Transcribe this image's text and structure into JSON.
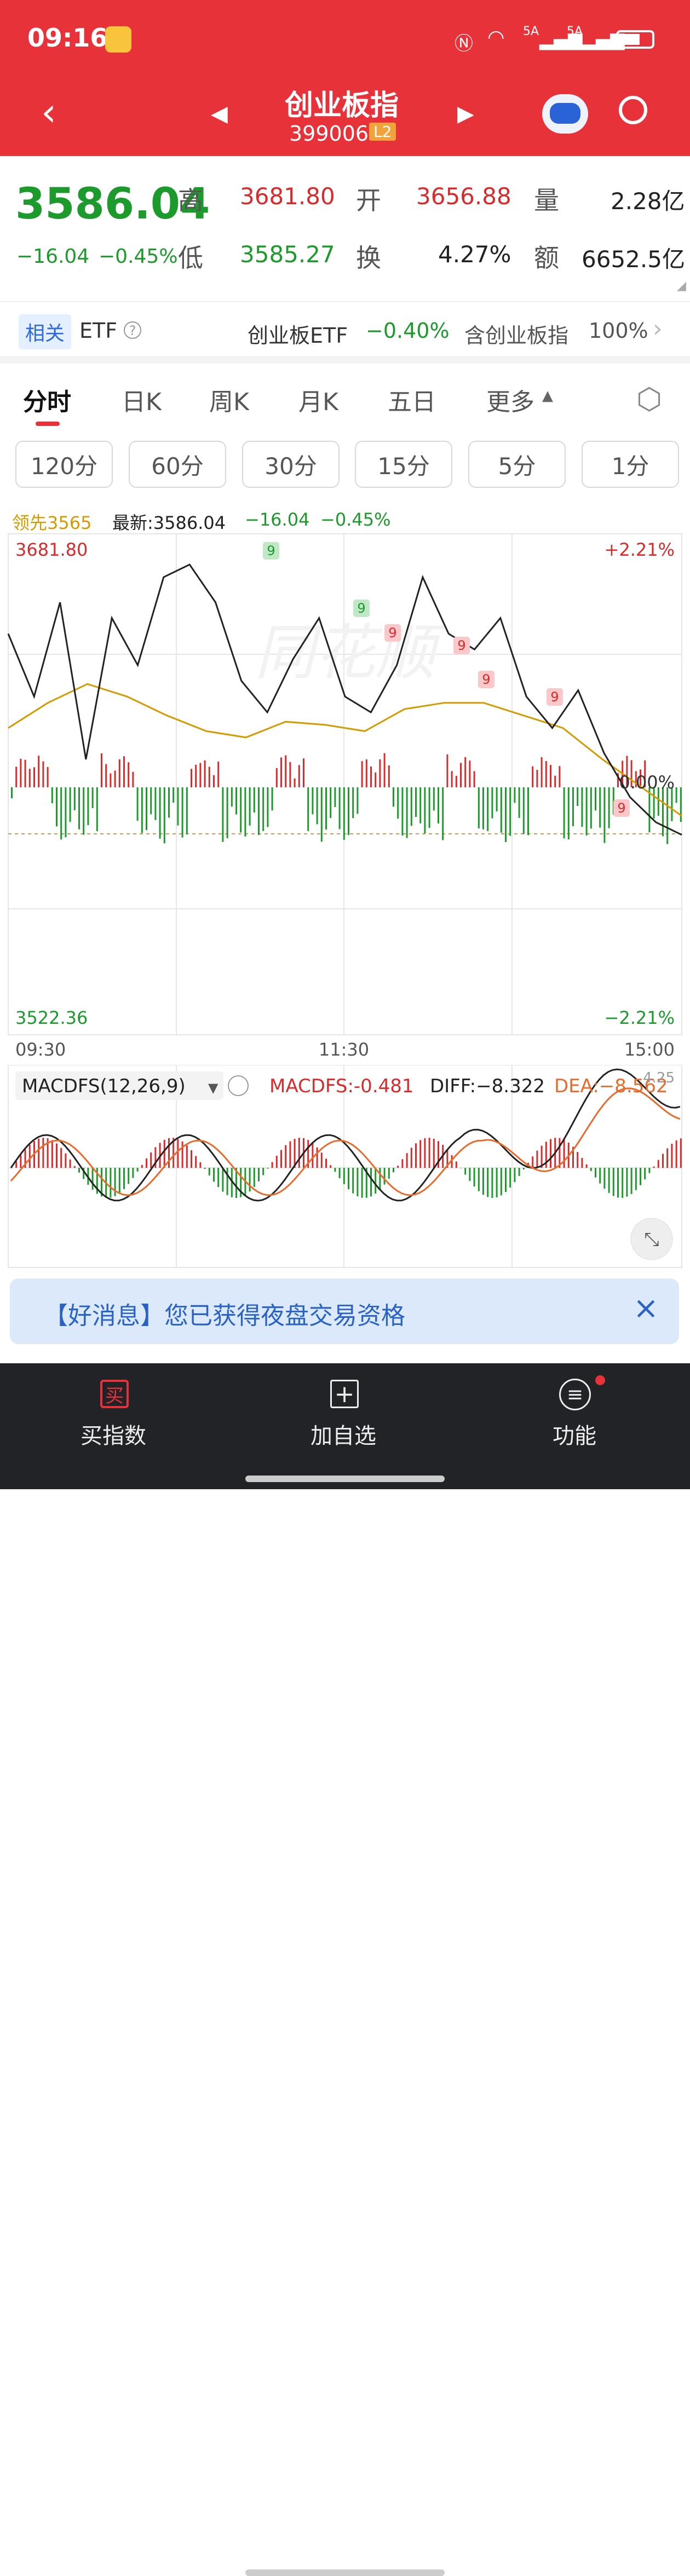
{
  "status_bar": {
    "time": "09:16",
    "signal1": "5A",
    "signal2": "5A"
  },
  "header": {
    "title": "创业板指",
    "code": "399006",
    "badge": "L2"
  },
  "quote": {
    "price": "3586.04",
    "change": "−16.04",
    "change_pct": "−0.45%",
    "high_label": "高",
    "high": "3681.80",
    "low_label": "低",
    "low": "3585.27",
    "open_label": "开",
    "open": "3656.88",
    "turnover_label": "换",
    "turnover": "4.27%",
    "volume_label": "量",
    "volume": "2.28亿",
    "amount_label": "额",
    "amount": "6652.5亿"
  },
  "etf": {
    "tag": "相关",
    "label": "ETF",
    "name": "创业板ETF",
    "pct": "−0.40%",
    "contains": "含创业板指",
    "weight": "100%"
  },
  "tabs": [
    "分时",
    "日K",
    "周K",
    "月K",
    "五日",
    "更多"
  ],
  "periods": [
    "120分",
    "60分",
    "30分",
    "15分",
    "5分",
    "1分"
  ],
  "chart_info": {
    "lead": "领先3565",
    "latest": "最新:3586.04",
    "chg": "−16.04",
    "pct": "−0.45%"
  },
  "chart_labels": {
    "top_price": "3681.80",
    "bottom_price": "3522.36",
    "top_pct": "+2.21%",
    "bottom_pct": "−2.21%",
    "mid_pct": "0.00%",
    "time_start": "09:30",
    "time_mid": "11:30",
    "time_end": "15:00",
    "watermark": "同花顺"
  },
  "macd": {
    "name": "MACDFS(12,26,9)",
    "macdfs": "MACDFS:-0.481",
    "diff": "DIFF:−8.322",
    "dea": "DEA:−8.562",
    "top_value": "4.25"
  },
  "banner": {
    "text": "【好消息】您已获得夜盘交易资格"
  },
  "bottom_nav": [
    {
      "icon": "buy-icon",
      "label": "买指数",
      "glyph": "买"
    },
    {
      "icon": "add-favorite-icon",
      "label": "加自选",
      "glyph": "+"
    },
    {
      "icon": "menu-icon",
      "label": "功能",
      "glyph": "≡"
    }
  ],
  "colors": {
    "brand_red": "#e8323a",
    "up_red": "#d92b2b",
    "down_green": "#1c9a2c",
    "avg_gold": "#d49a00"
  },
  "chart_data": {
    "type": "line",
    "ylim": [
      3522.36,
      3681.8
    ],
    "x": [
      "09:30",
      "11:30",
      "15:00"
    ],
    "series": [
      {
        "values": [
          3650,
          3630,
          3660,
          3610,
          3655,
          3640,
          3668,
          3672,
          3660,
          3635,
          3625,
          3642,
          3655,
          3630,
          3625,
          3640,
          3668,
          3650,
          3645,
          3655,
          3630,
          3620,
          3632,
          3612,
          3598,
          3590,
          3586
        ]
      },
      {
        "values": [
          3620,
          3628,
          3634,
          3630,
          3624,
          3619,
          3617,
          3622,
          3621,
          3619,
          3626,
          3628,
          3628,
          3624,
          3620,
          3610,
          3601,
          3592
        ]
      }
    ]
  }
}
